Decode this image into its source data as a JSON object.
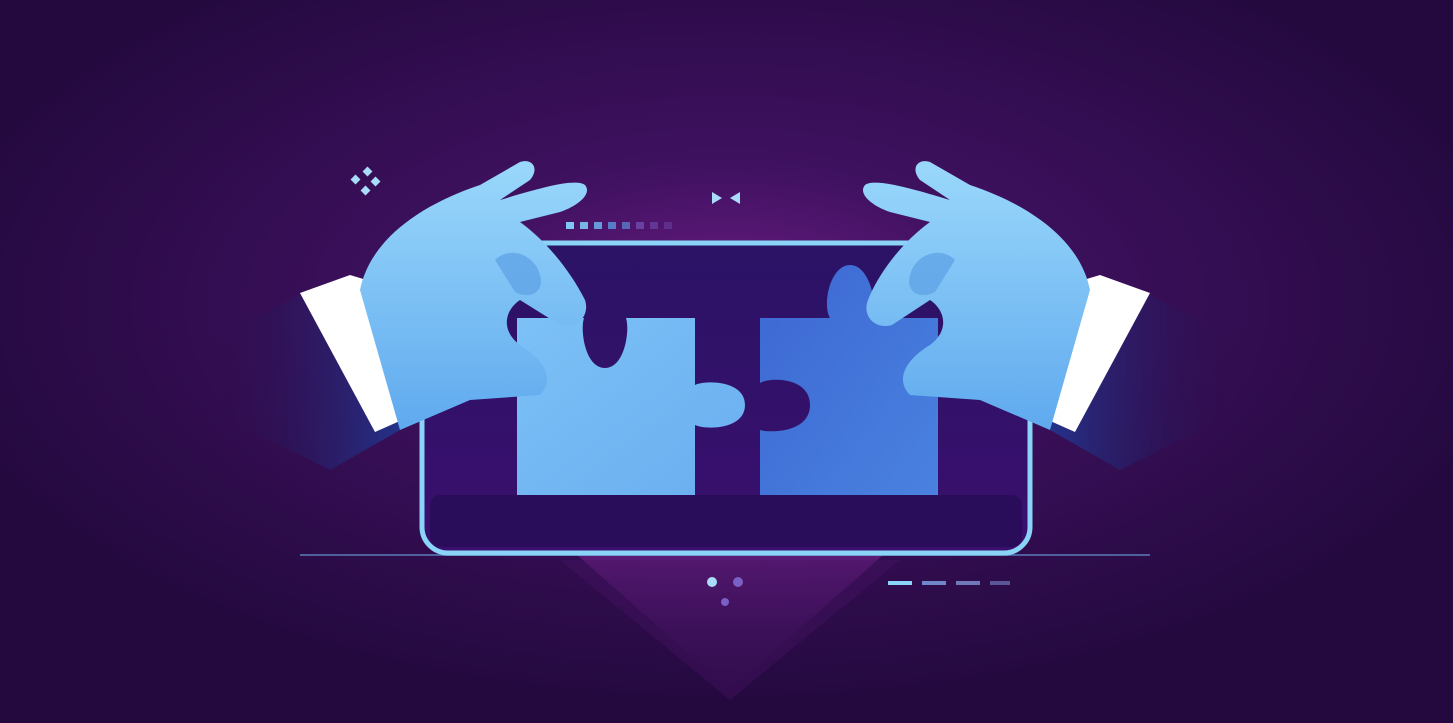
{
  "illustration": {
    "subject": "hands-joining-puzzle-pieces",
    "icons": [
      "sparkle-icon",
      "bowtie-icon",
      "dots-icon",
      "dash-line-icon"
    ]
  },
  "colors": {
    "background": "#2a0a45",
    "glow": "#7a1f8f",
    "frame": "#8ad4f7",
    "glove_light": "#8fd0fa",
    "glove_mid": "#5aa6ec",
    "piece_left": "#75b8f3",
    "piece_right": "#3f73d8",
    "sleeve": "#1c2c78",
    "cuff": "#ffffff"
  }
}
